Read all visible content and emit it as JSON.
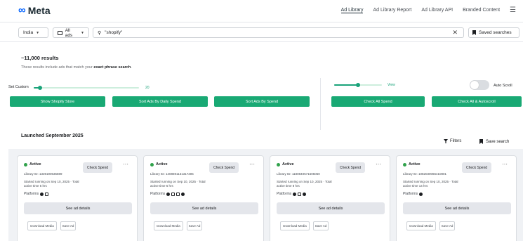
{
  "header": {
    "brand": "Meta",
    "nav": [
      "Ad Library",
      "Ad Library Report",
      "Ad Library API",
      "Branded Content"
    ]
  },
  "search": {
    "country": "India",
    "ad_category": "All ads",
    "query": "\"shopify\"",
    "saved_searches_label": "Saved searches"
  },
  "results": {
    "count": "~11,000 results",
    "note_prefix": "These results include ads that match your ",
    "note_emphasis": "exact phrase search",
    "note_suffix": "."
  },
  "controls": {
    "set_custom_label": "Set Custom",
    "slider1_value": "20",
    "slider1_fraction": 0.06,
    "slider2_value": "View",
    "slider2_fraction": 0.5,
    "auto_scroll_label": "Auto Scroll",
    "auto_scroll_on": false,
    "buttons": [
      "Show Shopify Store",
      "Sort Ads By Daily Spend",
      "Sort Ads By Spend",
      "Check All Spend",
      "Check All & Autoscroll"
    ],
    "accent_color": "#19a974"
  },
  "toolbar": {
    "filters_label": "Filters",
    "save_search_label": "Save search"
  },
  "section": {
    "title": "Launched September 2025"
  },
  "cards": [
    {
      "status": "Active",
      "check_label": "Check Spend",
      "library_id": "Library ID: 1339190636889",
      "started": "Started running on Sep 10, 2025 · Total active time 5 hrs",
      "platforms_label": "Platforms",
      "see_details": "See ad details",
      "download_label": "Download Media",
      "save_label": "Save Ad"
    },
    {
      "status": "Active",
      "check_label": "Check Spend",
      "library_id": "Library ID: 1408691131317305",
      "started": "Started running on Sep 10, 2025 · Total active time 6 hrs",
      "platforms_label": "Platforms",
      "see_details": "See ad details",
      "download_label": "Download Media",
      "save_label": "Save Ad"
    },
    {
      "status": "Active",
      "check_label": "Check Spend",
      "library_id": "Library ID: 1180840571505050",
      "started": "Started running on Sep 10, 2025 · Total active time 8 hrs",
      "platforms_label": "Platforms",
      "see_details": "See ad details",
      "download_label": "Download Media",
      "save_label": "Save Ad"
    },
    {
      "status": "Active",
      "check_label": "Check Spend",
      "library_id": "Library ID: 1082030066410801",
      "started": "Started running on Sep 10, 2025 · Total active time 14 hrs",
      "platforms_label": "Platforms",
      "see_details": "See ad details",
      "download_label": "Download Media",
      "save_label": "Save Ad"
    }
  ]
}
